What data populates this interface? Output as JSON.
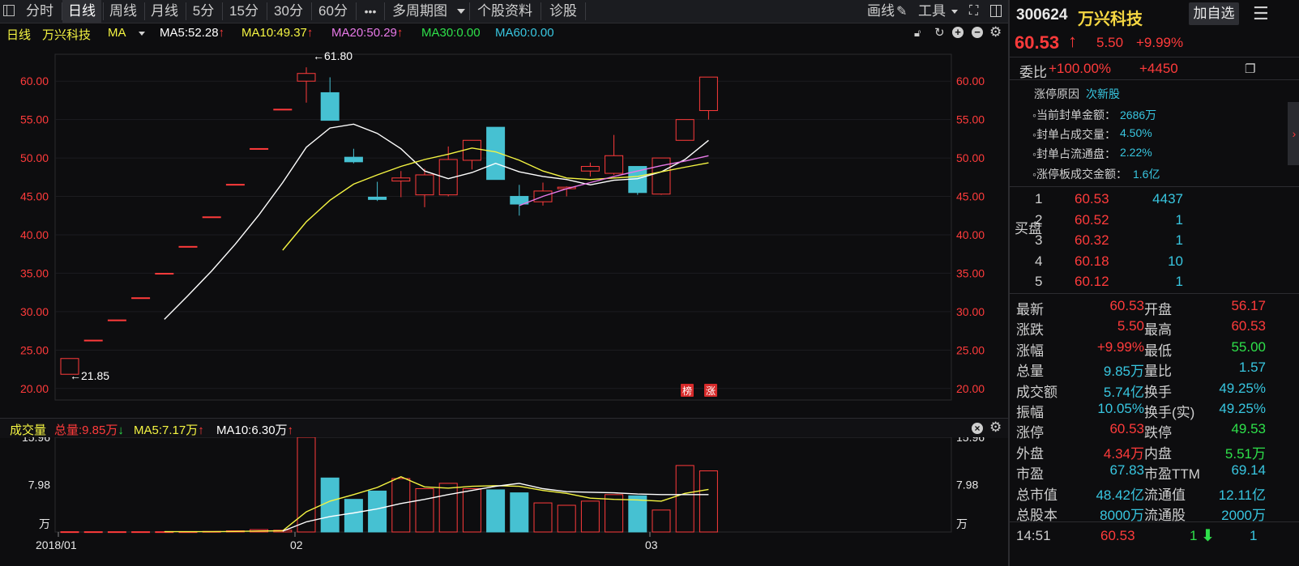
{
  "toolbar": {
    "tabs": [
      {
        "label": "分时",
        "active": false
      },
      {
        "label": "日线",
        "active": true
      },
      {
        "label": "周线",
        "active": false
      },
      {
        "label": "月线",
        "active": false
      },
      {
        "label": "5分",
        "active": false
      },
      {
        "label": "15分",
        "active": false
      },
      {
        "label": "30分",
        "active": false
      },
      {
        "label": "60分",
        "active": false
      }
    ],
    "more": "•••",
    "multi_period": "多周期图",
    "stock_info": "个股资料",
    "diagnose": "诊股",
    "draw": "画线",
    "tools": "工具"
  },
  "ma_bar": {
    "period": "日线",
    "stock_name": "万兴科技",
    "ma_selector": "MA",
    "ma5": "MA5:52.28",
    "ma10": "MA10:49.37",
    "ma20": "MA20:50.29",
    "ma30": "MA30:0.00",
    "ma60": "MA60:0.00",
    "colors": {
      "ma5": "#ffffff",
      "ma10": "#f5f542",
      "ma20": "#e879e8",
      "ma30": "#2ee04a",
      "ma60": "#38c6e0"
    }
  },
  "chart_data": [
    {
      "type": "candlestick",
      "title": "",
      "y_ticks": [
        20,
        25,
        30,
        35,
        40,
        45,
        50,
        55,
        60
      ],
      "y_tick_labels": [
        "20.00",
        "25.00",
        "30.00",
        "35.00",
        "40.00",
        "45.00",
        "50.00",
        "55.00",
        "60.00"
      ],
      "ylim": [
        18.5,
        63.5
      ],
      "x_labels": [
        {
          "index": 0,
          "label": "2018/01"
        },
        {
          "index": 10,
          "label": "02"
        },
        {
          "index": 25,
          "label": "03"
        }
      ],
      "candles": [
        {
          "o": 21.85,
          "c": 23.9,
          "h": 23.9,
          "l": 21.85
        },
        {
          "o": 26.29,
          "c": 26.29,
          "h": 26.29,
          "l": 26.29
        },
        {
          "o": 28.92,
          "c": 28.92,
          "h": 28.92,
          "l": 28.92
        },
        {
          "o": 31.81,
          "c": 31.81,
          "h": 31.81,
          "l": 31.81
        },
        {
          "o": 34.99,
          "c": 34.99,
          "h": 34.99,
          "l": 34.99
        },
        {
          "o": 38.49,
          "c": 38.49,
          "h": 38.49,
          "l": 38.49
        },
        {
          "o": 42.34,
          "c": 42.34,
          "h": 42.34,
          "l": 42.34
        },
        {
          "o": 46.57,
          "c": 46.57,
          "h": 46.57,
          "l": 46.57
        },
        {
          "o": 51.23,
          "c": 51.23,
          "h": 51.23,
          "l": 51.23
        },
        {
          "o": 56.35,
          "c": 56.35,
          "h": 56.35,
          "l": 56.35
        },
        {
          "o": 60.0,
          "c": 61.0,
          "h": 61.8,
          "l": 57.2
        },
        {
          "o": 58.5,
          "c": 54.9,
          "h": 60.5,
          "l": 54.9
        },
        {
          "o": 50.1,
          "c": 49.5,
          "h": 51.2,
          "l": 49.3
        },
        {
          "o": 44.9,
          "c": 44.6,
          "h": 46.9,
          "l": 44.4
        },
        {
          "o": 47.0,
          "c": 47.4,
          "h": 48.3,
          "l": 44.9
        },
        {
          "o": 45.2,
          "c": 47.8,
          "h": 48.6,
          "l": 43.6
        },
        {
          "o": 45.2,
          "c": 49.8,
          "h": 51.5,
          "l": 45.0
        },
        {
          "o": 49.7,
          "c": 52.3,
          "h": 52.3,
          "l": 48.5
        },
        {
          "o": 54.0,
          "c": 47.2,
          "h": 54.0,
          "l": 47.2
        },
        {
          "o": 45.0,
          "c": 44.0,
          "h": 46.5,
          "l": 42.5
        },
        {
          "o": 44.3,
          "c": 45.7,
          "h": 46.8,
          "l": 43.8
        },
        {
          "o": 46.0,
          "c": 46.2,
          "h": 46.3,
          "l": 45.0
        },
        {
          "o": 48.3,
          "c": 48.9,
          "h": 49.4,
          "l": 47.6
        },
        {
          "o": 48.0,
          "c": 50.3,
          "h": 53.0,
          "l": 47.8
        },
        {
          "o": 48.9,
          "c": 45.5,
          "h": 48.9,
          "l": 45.2
        },
        {
          "o": 45.3,
          "c": 50.0,
          "h": 50.0,
          "l": 45.2
        },
        {
          "o": 52.3,
          "c": 55.0,
          "h": 55.0,
          "l": 52.3
        },
        {
          "o": 56.17,
          "c": 60.53,
          "h": 60.53,
          "l": 55.0
        }
      ],
      "ma5": [
        null,
        null,
        null,
        null,
        29.0,
        32.1,
        35.3,
        38.8,
        42.6,
        46.8,
        51.4,
        53.9,
        54.4,
        53.2,
        51.2,
        48.3,
        47.3,
        48.1,
        49.3,
        48.2,
        47.6,
        47.2,
        46.5,
        47.1,
        47.3,
        48.2,
        49.8,
        52.3
      ],
      "ma10": [
        null,
        null,
        null,
        null,
        null,
        null,
        null,
        null,
        null,
        38.0,
        41.7,
        44.5,
        46.6,
        47.8,
        48.9,
        49.8,
        50.5,
        51.3,
        50.8,
        49.7,
        48.3,
        47.4,
        47.2,
        47.4,
        47.6,
        48.2,
        48.8,
        49.37
      ],
      "ma20": [
        null,
        null,
        null,
        null,
        null,
        null,
        null,
        null,
        null,
        null,
        null,
        null,
        null,
        null,
        null,
        null,
        null,
        null,
        null,
        43.8,
        45.0,
        46.0,
        46.8,
        47.6,
        48.3,
        49.0,
        49.6,
        50.29
      ],
      "annotations": [
        {
          "index": 10,
          "text": "←61.80",
          "value": 61.8
        },
        {
          "index": 0,
          "text": "←21.85",
          "value": 21.85
        }
      ],
      "markers": [
        "榜",
        "涨"
      ]
    },
    {
      "type": "bar",
      "title": "成交量",
      "total": "总量:9.85万",
      "ma5_label": "MA5:7.17万",
      "ma10_label": "MA10:6.30万",
      "unit": "万",
      "y_ticks": [
        15.96,
        7.98
      ],
      "y_tick_labels": [
        "15.96",
        "7.98"
      ],
      "ylim": [
        0,
        15.96
      ],
      "values": [
        0.05,
        0.05,
        0.05,
        0.05,
        0.05,
        0.05,
        0.1,
        0.2,
        0.4,
        0.3,
        15.96,
        9.1,
        5.5,
        6.9,
        9.0,
        7.3,
        8.2,
        7.3,
        7.1,
        6.6,
        4.9,
        4.5,
        5.2,
        6.3,
        6.1,
        3.7,
        11.2,
        10.3
      ],
      "up": [
        true,
        true,
        true,
        true,
        true,
        true,
        true,
        true,
        true,
        true,
        true,
        false,
        false,
        false,
        true,
        true,
        true,
        true,
        false,
        false,
        true,
        true,
        true,
        true,
        false,
        true,
        true,
        true
      ],
      "ma5": [
        null,
        null,
        null,
        null,
        0.05,
        0.05,
        0.06,
        0.09,
        0.16,
        0.21,
        3.4,
        5.2,
        6.3,
        7.5,
        9.3,
        7.6,
        7.4,
        7.7,
        7.8,
        7.7,
        7.0,
        6.5,
        5.7,
        5.5,
        5.4,
        5.2,
        6.5,
        7.17
      ],
      "ma10": [
        null,
        null,
        null,
        null,
        null,
        null,
        null,
        null,
        null,
        0.13,
        1.7,
        2.6,
        3.2,
        3.9,
        4.8,
        5.5,
        6.3,
        7.0,
        7.7,
        8.2,
        7.3,
        6.8,
        6.7,
        6.6,
        6.4,
        6.3,
        6.3,
        6.3
      ]
    }
  ],
  "right_panel": {
    "code": "300624",
    "name": "万兴科技",
    "add_watch": "加自选",
    "price": "60.53",
    "change": "5.50",
    "change_pct": "+9.99%",
    "weibi_label": "委比",
    "weibi_value": "+100.00%",
    "weicha_value": "+4450",
    "limit_reason_label": "涨停原因",
    "limit_reason": "次新股",
    "seal_items": [
      {
        "label": "当前封单金额：",
        "value": "2686万"
      },
      {
        "label": "封单占成交量：",
        "value": "4.50%"
      },
      {
        "label": "封单占流通盘：",
        "value": "2.22%"
      },
      {
        "label": "涨停板成交金额：",
        "value": "1.6亿"
      }
    ],
    "buy_label": "买盘",
    "bids": [
      {
        "level": "1",
        "price": "60.53",
        "vol": "4437"
      },
      {
        "level": "2",
        "price": "60.52",
        "vol": "1"
      },
      {
        "level": "3",
        "price": "60.32",
        "vol": "1"
      },
      {
        "level": "4",
        "price": "60.18",
        "vol": "10"
      },
      {
        "level": "5",
        "price": "60.12",
        "vol": "1"
      }
    ],
    "stats": [
      {
        "l1": "最新",
        "v1": "60.53",
        "c1": "red",
        "l2": "开盘",
        "v2": "56.17",
        "c2": "red"
      },
      {
        "l1": "涨跌",
        "v1": "5.50",
        "c1": "red",
        "l2": "最高",
        "v2": "60.53",
        "c2": "red"
      },
      {
        "l1": "涨幅",
        "v1": "+9.99%",
        "c1": "red",
        "l2": "最低",
        "v2": "55.00",
        "c2": "green"
      },
      {
        "l1": "总量",
        "v1": "9.85万",
        "c1": "cyan",
        "l2": "量比",
        "v2": "1.57",
        "c2": "cyan"
      },
      {
        "l1": "成交额",
        "v1": "5.74亿",
        "c1": "cyan",
        "l2": "换手",
        "v2": "49.25%",
        "c2": "cyan"
      },
      {
        "l1": "振幅",
        "v1": "10.05%",
        "c1": "cyan",
        "l2": "换手(实)",
        "v2": "49.25%",
        "c2": "cyan"
      },
      {
        "l1": "涨停",
        "v1": "60.53",
        "c1": "red",
        "l2": "跌停",
        "v2": "49.53",
        "c2": "green"
      },
      {
        "l1": "外盘",
        "v1": "4.34万",
        "c1": "red",
        "l2": "内盘",
        "v2": "5.51万",
        "c2": "green"
      },
      {
        "l1": "市盈",
        "v1": "67.83",
        "c1": "cyan",
        "l2": "市盈TTM",
        "v2": "69.14",
        "c2": "cyan"
      },
      {
        "l1": "总市值",
        "v1": "48.42亿",
        "c1": "cyan",
        "l2": "流通值",
        "v2": "12.11亿",
        "c2": "cyan"
      },
      {
        "l1": "总股本",
        "v1": "8000万",
        "c1": "cyan",
        "l2": "流通股",
        "v2": "2000万",
        "c2": "cyan"
      }
    ],
    "tick": {
      "time": "14:51",
      "price": "60.53",
      "vol": "1",
      "count": "1"
    }
  }
}
